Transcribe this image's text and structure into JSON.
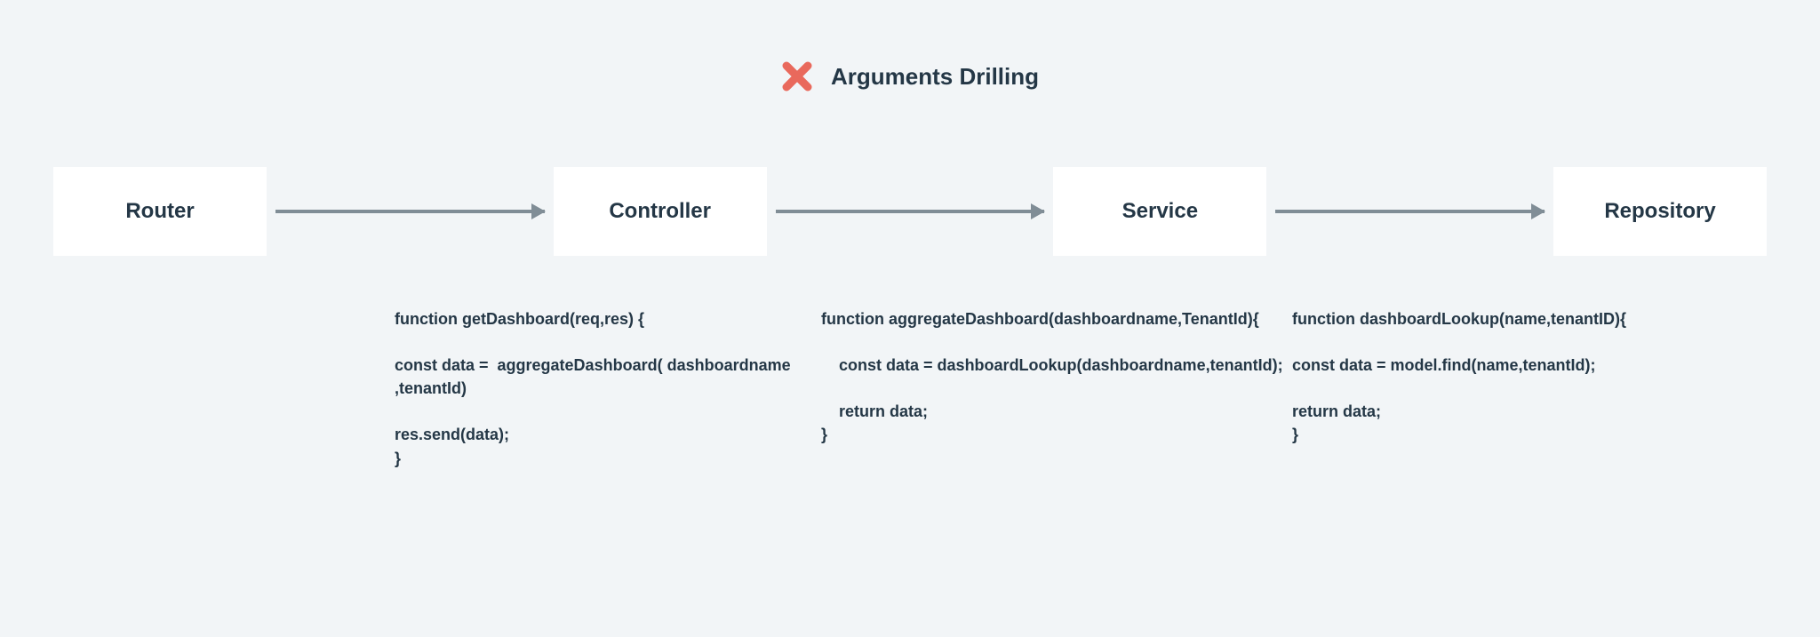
{
  "title": "Arguments Drilling",
  "icon": "x-icon",
  "accent_color": "#e9695c",
  "text_color": "#243746",
  "boxes": {
    "router": "Router",
    "controller": "Controller",
    "service": "Service",
    "repository": "Repository"
  },
  "code": {
    "controller": "function getDashboard(req,res) {\n\nconst data =  aggregateDashboard( dashboardname ,tenantId)\n\nres.send(data);\n}",
    "service": "function aggregateDashboard(dashboardname,TenantId){\n\n    const data = dashboardLookup(dashboardname,tenantId);\n\n    return data;\n}",
    "repository": "function dashboardLookup(name,tenantID){\n\nconst data = model.find(name,tenantId);\n\nreturn data;\n}"
  }
}
